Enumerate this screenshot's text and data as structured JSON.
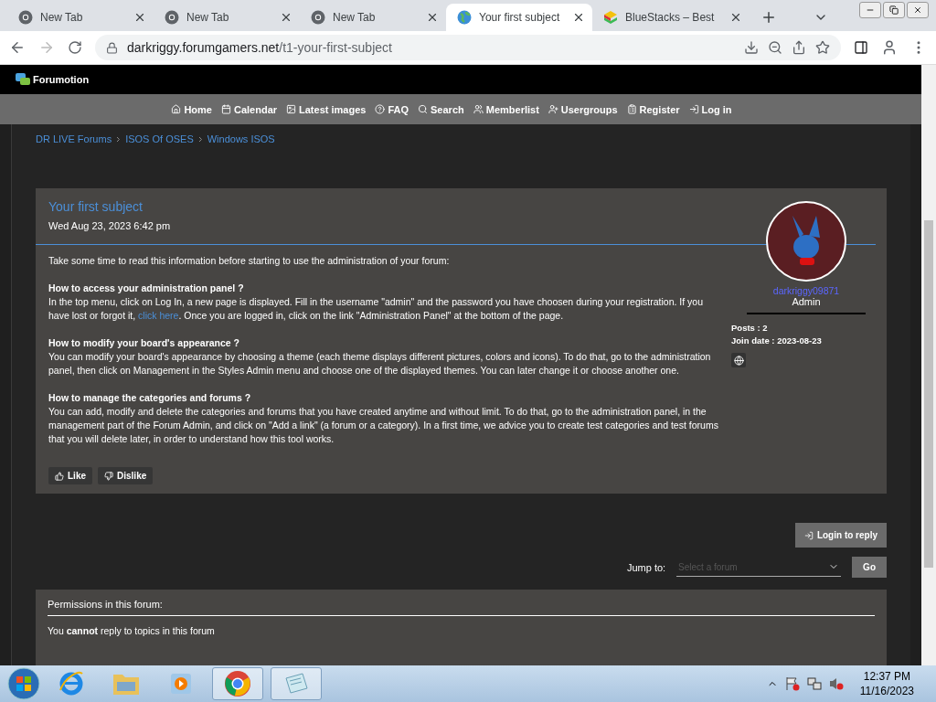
{
  "browser": {
    "tabs": [
      {
        "title": "New Tab",
        "kind": "chrome",
        "selected": false
      },
      {
        "title": "New Tab",
        "kind": "chrome",
        "selected": false
      },
      {
        "title": "New Tab",
        "kind": "chrome",
        "selected": false
      },
      {
        "title": "Your first subject",
        "kind": "globe",
        "selected": true
      },
      {
        "title": "BlueStacks – Best",
        "kind": "app",
        "selected": false
      }
    ],
    "url": {
      "domain": "darkriggy.forumgamers.net",
      "path": "/t1-your-first-subject"
    }
  },
  "forum": {
    "brand": "Forumotion",
    "nav": [
      {
        "label": "Home",
        "kind": "home"
      },
      {
        "label": "Calendar",
        "kind": "calendar"
      },
      {
        "label": "Latest images",
        "kind": "images"
      },
      {
        "label": "FAQ",
        "kind": "faq"
      },
      {
        "label": "Search",
        "kind": "search"
      },
      {
        "label": "Memberlist",
        "kind": "members"
      },
      {
        "label": "Usergroups",
        "kind": "groups"
      },
      {
        "label": "Register",
        "kind": "register"
      },
      {
        "label": "Log in",
        "kind": "login"
      }
    ],
    "breadcrumbs": [
      "DR LIVE Forums",
      "ISOS Of OSES",
      "Windows ISOS"
    ],
    "post": {
      "title": "Your first subject",
      "date": "Wed Aug 23, 2023 6:42 pm",
      "intro": "Take some time to read this information before starting to use the administration of your forum:",
      "sections": [
        {
          "heading": "How to access your administration panel ?",
          "before": "In the top menu, click on Log In, a new page is displayed. Fill in the username \"admin\" and the password you have choosen during your registration. If you have lost or forgot it, ",
          "link": "click here",
          "after": ". Once you are logged in, click on the link \"Administration Panel\" at the bottom of the page."
        },
        {
          "heading": "How to modify your board's appearance ?",
          "before": "You can modify your board's appearance by choosing a theme (each theme displays different pictures, colors and icons). To do that, go to the administration panel, then click on Management in the Styles Admin menu and choose one of the displayed themes. You can later change it or choose another one."
        },
        {
          "heading": "How to manage the categories and forums ?",
          "before": "You can add, modify and delete the categories and forums that you have created anytime and without limit. To do that, go to the administration panel, in the management part of the Forum Admin, and click on \"Add a link\" (a forum or a category). In a first time, we advice you to create test categories and test forums that you will delete later, in order to understand how this tool works."
        }
      ],
      "reactions": [
        {
          "label": "Like",
          "kind": "up"
        },
        {
          "label": "Dislike",
          "kind": "down"
        }
      ],
      "author": {
        "name": "darkriggy09871",
        "role": "Admin",
        "stats": [
          "Posts : 2",
          "Join date : 2023-08-23"
        ]
      }
    },
    "reply_button": "Login to reply",
    "jump": {
      "label": "Jump to:",
      "placeholder": "Select a forum",
      "button": "Go"
    },
    "permissions": {
      "title": "Permissions in this forum:",
      "text": "You **cannot** reply to topics in this forum"
    }
  },
  "taskbar": {
    "apps": [
      {
        "kind": "ie",
        "active": false
      },
      {
        "kind": "explorer",
        "active": false
      },
      {
        "kind": "media",
        "active": false
      },
      {
        "kind": "chrome",
        "active": true
      },
      {
        "kind": "notepad",
        "active": true
      }
    ],
    "clock": {
      "time": "12:37 PM",
      "date": "11/16/2023"
    }
  }
}
